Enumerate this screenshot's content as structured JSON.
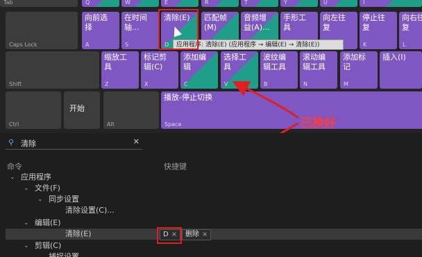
{
  "keyboard": {
    "row0": [
      {
        "letter": "Tab",
        "cmd": ""
      },
      {
        "letter": "Q",
        "cmd": ""
      },
      {
        "letter": "W",
        "cmd": ""
      },
      {
        "letter": "E",
        "cmd": ""
      },
      {
        "letter": "R",
        "cmd": ""
      },
      {
        "letter": "T",
        "cmd": ""
      },
      {
        "letter": "Y",
        "cmd": ""
      },
      {
        "letter": "U",
        "cmd": ""
      },
      {
        "letter": "I",
        "cmd": ""
      }
    ],
    "row1": [
      {
        "letter": "Caps Lock",
        "cmd": ""
      },
      {
        "letter": "A",
        "cmd": "向前选\n择"
      },
      {
        "letter": "S",
        "cmd": "在时间\n轴..."
      },
      {
        "letter": "D",
        "cmd": "清除(E)"
      },
      {
        "letter": "F",
        "cmd": "匹配帧\n(M)"
      },
      {
        "letter": "G",
        "cmd": "音频增\n益(A)..."
      },
      {
        "letter": "H",
        "cmd": "手形工\n具"
      },
      {
        "letter": "J",
        "cmd": "向左往\n复"
      },
      {
        "letter": "K",
        "cmd": "停止往\n复"
      },
      {
        "letter": "L",
        "cmd": "向右往\n复"
      }
    ],
    "row2": [
      {
        "letter": "Shift",
        "cmd": ""
      },
      {
        "letter": "Z",
        "cmd": "缩放工\n具"
      },
      {
        "letter": "X",
        "cmd": "标记剪\n辑(C)"
      },
      {
        "letter": "C",
        "cmd": "添加编\n辑"
      },
      {
        "letter": "V",
        "cmd": "选择工\n具"
      },
      {
        "letter": "B",
        "cmd": "波纹编\n辑工具"
      },
      {
        "letter": "N",
        "cmd": "滚动编\n辑工具"
      },
      {
        "letter": "M",
        "cmd": "添加标\n记"
      },
      {
        "letter": "",
        "cmd": "插入(I)"
      }
    ],
    "row3": [
      {
        "letter": "Ctrl",
        "cmd": ""
      },
      {
        "letter": "",
        "cmd": "开始"
      },
      {
        "letter": "Alt",
        "cmd": ""
      },
      {
        "letter": "Space",
        "cmd": "播放-停止切换"
      }
    ]
  },
  "tooltip": "应用程序: 清除(E) (应用程序 → 编辑(E) → 清除(E))",
  "annotation": "已换好",
  "search": {
    "value": "清除"
  },
  "columns": {
    "command": "命令",
    "shortcut": "快捷键"
  },
  "tree": [
    {
      "label": "应用程序",
      "level": 0
    },
    {
      "label": "文件(F)",
      "level": 1
    },
    {
      "label": "同步设置",
      "level": 2
    },
    {
      "label": "清除设置(C)...",
      "level": 3
    },
    {
      "label": "编辑(E)",
      "level": 1
    },
    {
      "label": "清除(E)",
      "level": 3
    },
    {
      "label": "剪辑(C)",
      "level": 1
    },
    {
      "label": "捕捉设置...",
      "level": 2
    }
  ],
  "shortcuts": [
    {
      "key": "D"
    },
    {
      "key": "删除"
    }
  ],
  "colors": {
    "purple": "#7e57c2",
    "teal": "#1f9e8a",
    "red": "#e02020"
  }
}
